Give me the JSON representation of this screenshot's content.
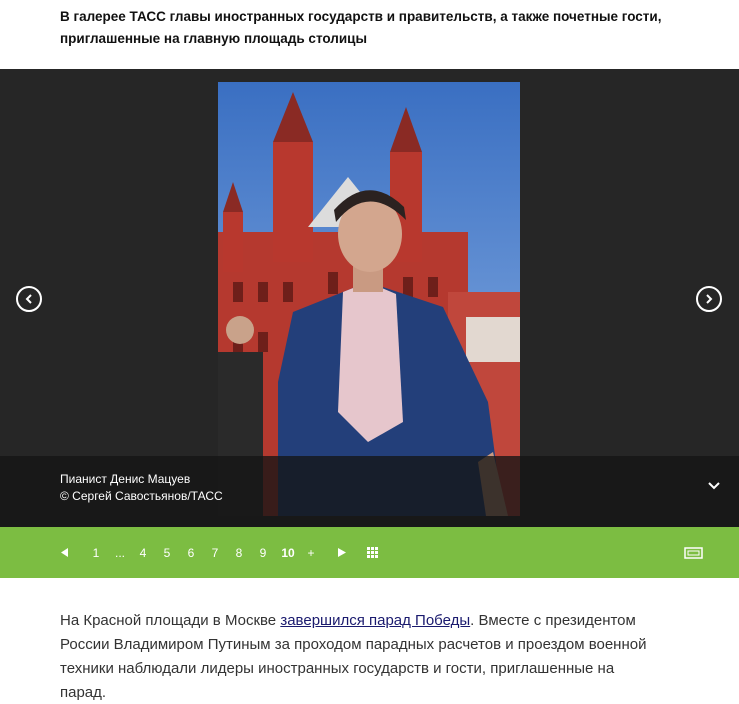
{
  "lead": {
    "text": "В галерее ТАСС главы иностранных государств и правительств, а также почетные гости, приглашенные на главную площадь столицы"
  },
  "gallery": {
    "caption_title": "Пианист Денис Мацуев",
    "caption_credit": "© Сергей Савостьянов/ТАСС",
    "icons": {
      "prev": "arrow-left-circle-icon",
      "next": "arrow-right-circle-icon",
      "caption_toggle": "chevron-down-icon"
    }
  },
  "pager": {
    "items": [
      "1",
      "...",
      "4",
      "5",
      "6",
      "7",
      "8",
      "9",
      "10",
      "+"
    ],
    "current": "10",
    "icons": {
      "prev": "triangle-left-icon",
      "next": "triangle-right-icon",
      "grid": "grid-icon",
      "fullscreen": "fullscreen-icon"
    },
    "bar_color": "#7cbd42"
  },
  "article": {
    "text_before_link": "На Красной площади в Москве ",
    "link_text": "завершился парад Победы",
    "text_after_link": ". Вместе с президентом России Владимиром Путиным за проходом парадных расчетов и проездом военной техники наблюдали лидеры иностранных государств и гости, приглашенные на парад."
  }
}
